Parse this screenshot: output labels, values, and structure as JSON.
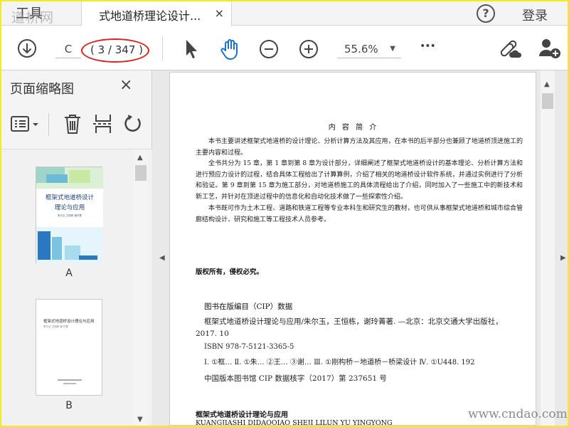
{
  "tabbar": {
    "tools_label": "工具",
    "watermark_left": "道桥网",
    "doc_tab_title": "式地道桥理论设计...",
    "close_glyph": "×",
    "help_glyph": "?",
    "login_label": "登录"
  },
  "toolbar": {
    "page_input_value": "C",
    "page_count": "( 3 / 347 )",
    "zoom_value": "55.6%",
    "more_glyph": "•••",
    "highlight_color": "#e0201c"
  },
  "left_panel": {
    "title": "页面缩略图",
    "close_glyph": "×",
    "thumbnails": [
      {
        "label": "A",
        "cover_title_line1": "框架式地道桥设计",
        "cover_title_line2": "理论与应用",
        "cover_authors": "朱尔玉 王恒栋 谢玲菁"
      },
      {
        "label": "B",
        "cover_title": "框架式地道桥设计理论与应用",
        "cover_authors": "朱尔玉 王恒栋 谢 玲菁"
      }
    ]
  },
  "page": {
    "heading": "内 容 简 介",
    "para1": "本书主要讲述框架式地道桥的设计理论、分析计算方法及其应用，在本书的后半部分也兼顾了地道桥顶进施工的主要内容和过程。",
    "para2": "全书共分为 15 章，第 1 章到第 8 章为设计部分，详细阐述了框架式地道桥设计的基本理论、分析计算方法和进行预应力设计的过程，结合具体工程给出了计算算例，介绍了相关的地道桥设计软件系统，并通过实例进行了分析和验证。第 9 章到第 15 章为施工部分，对地道桥施工的具体流程给出了介绍，同时加入了一些施工中的新技术和新工艺，并针对在顶进过程中的信息化和自动化技术做了一些探索性介绍。",
    "para3": "本书既可作为土木工程、道路和铁道工程等专业本科生和研究生的教材，也可供从事框架式地道桥和城市综合管廊结构设计、研究和施工等工程技术人员参考。",
    "rights": "版权所有，侵权必究。",
    "cip_head": "图书在版编目（CIP）数据",
    "cip_line1": "框架式地道桥设计理论与应用/朱尔玉，王恒栋，谢玲菁著. —北京：北京交通大学出版社，",
    "cip_line2": "2017. 10",
    "cip_isbn": "ISBN 978-7-5121-3365-5",
    "cip_class": "Ⅰ. ①框…  Ⅱ. ①朱…  ②王…  ③谢…  Ⅲ. ①刚构桥－地道桥－桥梁设计  Ⅳ. ①U448. 192",
    "cip_number": "中国版本图书馆 CIP 数据核字（2017）第 237651 号",
    "book_title_cn": "框架式地道桥设计理论与应用",
    "book_title_py": "KUANGJIASHI DIDAOQIAO SHEJI LILUN YU YINGYONG"
  },
  "watermark_br": "www.cndao.com"
}
